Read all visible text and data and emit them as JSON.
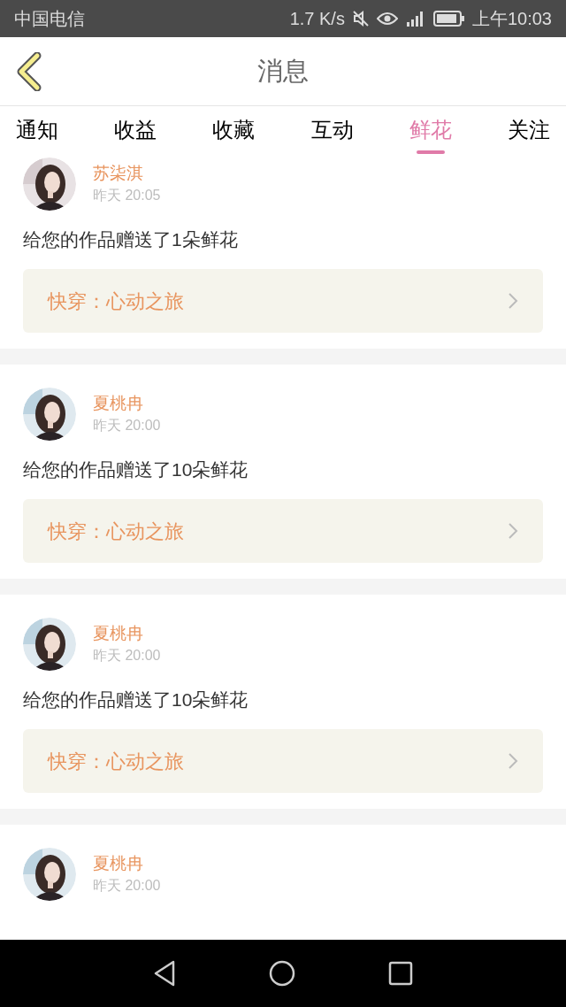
{
  "status_bar": {
    "carrier": "中国电信",
    "speed": "1.7 K/s",
    "time": "上午10:03"
  },
  "header": {
    "title": "消息"
  },
  "tabs": [
    {
      "label": "通知",
      "selected": false
    },
    {
      "label": "收益",
      "selected": false
    },
    {
      "label": "收藏",
      "selected": false
    },
    {
      "label": "互动",
      "selected": false
    },
    {
      "label": "鲜花",
      "selected": true
    },
    {
      "label": "关注",
      "selected": false
    }
  ],
  "messages": [
    {
      "kind": "picture",
      "name": "苏柒淇",
      "time": "昨天 20:05",
      "text": "给您的作品赠送了1朵鲜花",
      "work": "快穿：心动之旅"
    },
    {
      "kind": "picture",
      "name": "夏桃冉",
      "time": "昨天 20:00",
      "text": "给您的作品赠送了10朵鲜花",
      "work": "快穿：心动之旅"
    },
    {
      "kind": "picture",
      "name": "夏桃冉",
      "time": "昨天 20:00",
      "text": "给您的作品赠送了10朵鲜花",
      "work": "快穿：心动之旅"
    },
    {
      "kind": "picture",
      "name": "夏桃冉",
      "time": "昨天 20:00"
    }
  ]
}
